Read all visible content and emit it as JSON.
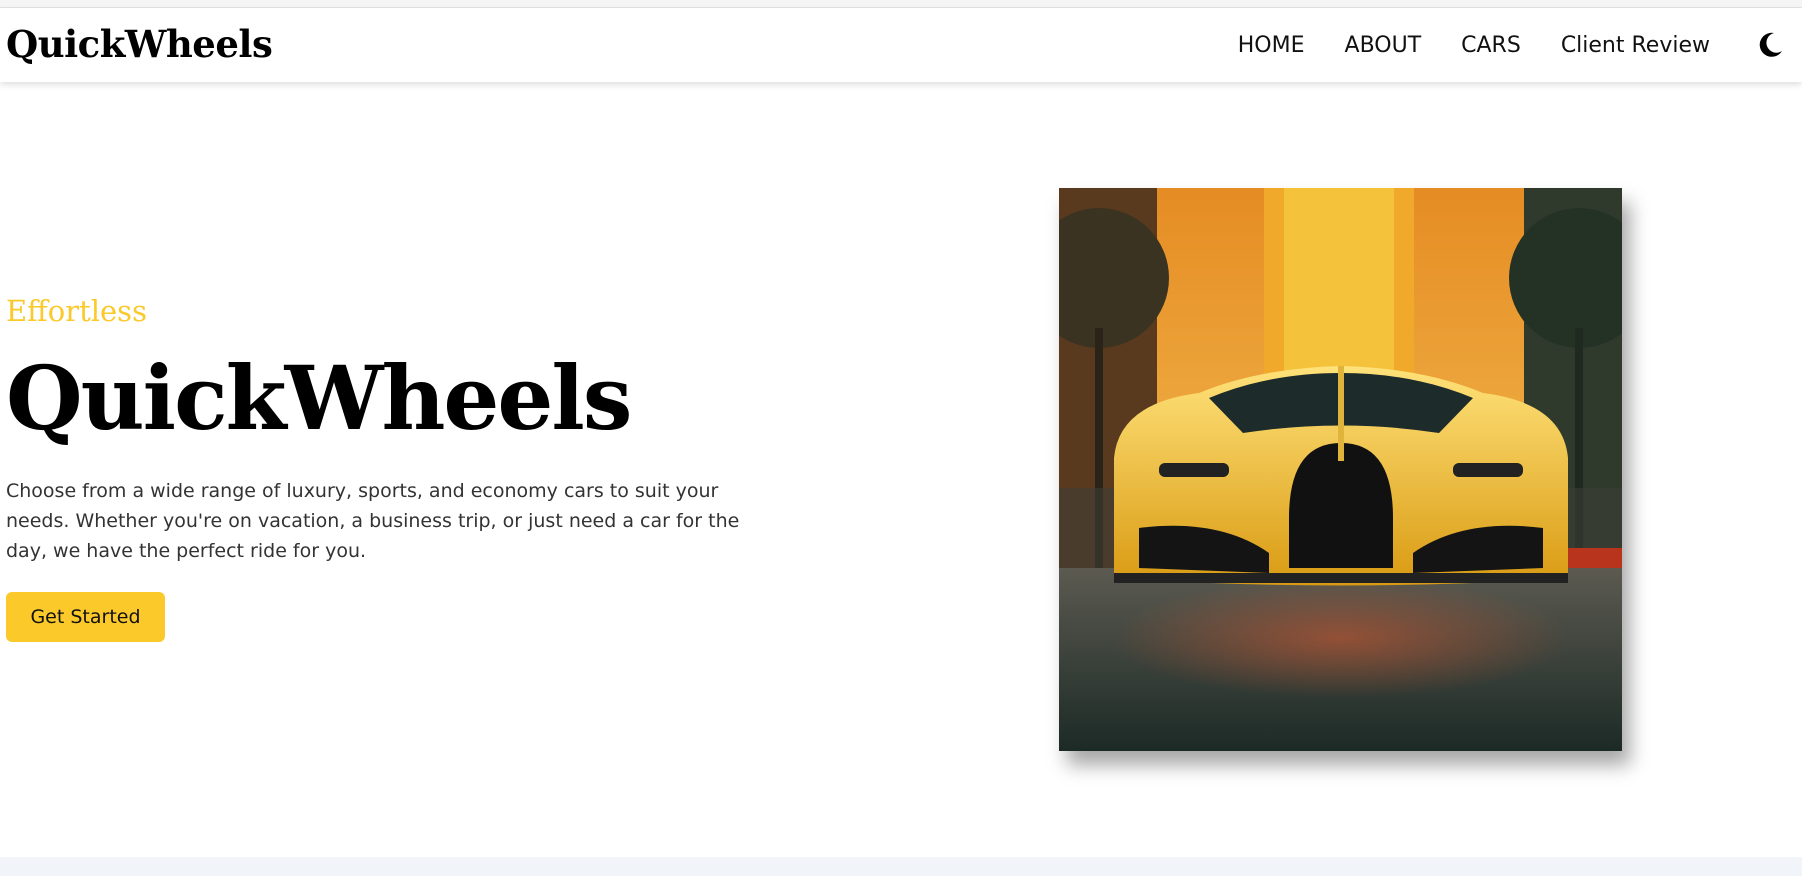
{
  "navbar": {
    "brand": "QuickWheels",
    "links": [
      {
        "label": "HOME"
      },
      {
        "label": "ABOUT"
      },
      {
        "label": "CARS"
      },
      {
        "label": "Client Review"
      }
    ],
    "theme_toggle_icon": "moon-icon"
  },
  "hero": {
    "tagline": "Effortless",
    "title": "QuickWheels",
    "description": "Choose from a wide range of luxury, sports, and economy cars to suit your needs. Whether you're on vacation, a business trip, or just need a car for the day, we have the perfect ride for you.",
    "cta_label": "Get Started",
    "image_subject": "yellow sports car"
  },
  "colors": {
    "accent": "#fbc929",
    "text": "#000000",
    "body_text": "#333333",
    "footer_band": "#f1f4f9"
  }
}
